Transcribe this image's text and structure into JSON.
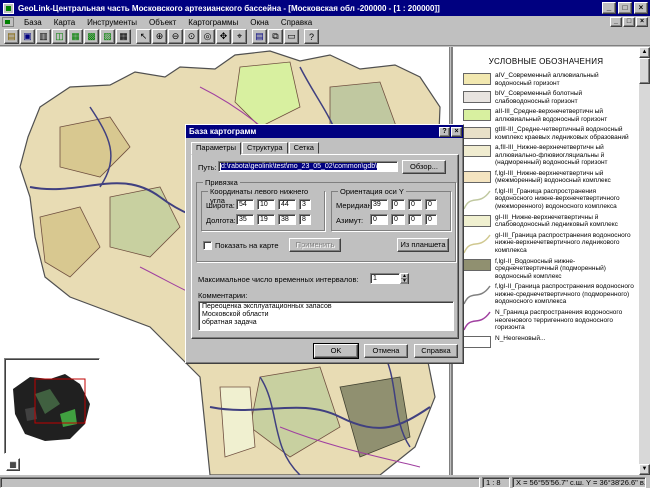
{
  "window": {
    "title": "GeoLink-Центральная часть Московского артезианского бассейна - [Московская обл -200000 - [1 : 200000]]",
    "controls": [
      "_",
      "□",
      "×"
    ],
    "mdi_controls": [
      "_",
      "□",
      "×"
    ]
  },
  "menu": {
    "items": [
      "База",
      "Карта",
      "Инструменты",
      "Объект",
      "Картограммы",
      "Окна",
      "Справка"
    ]
  },
  "toolbar": {
    "buttons": [
      "open-icon",
      "save-icon",
      "print-icon",
      "layers-icon",
      "chart-icon",
      "table-icon",
      "image-icon",
      "grid-icon",
      "pointer-icon",
      "zoom-in-icon",
      "zoom-out-icon",
      "zoom-extent-icon",
      "zoom-region-icon",
      "pan-icon",
      "measure-icon",
      "info-icon",
      "copy-icon",
      "clipboard-icon",
      "help-icon"
    ]
  },
  "legend": {
    "title": "УСЛОВНЫЕ ОБОЗНАЧЕНИЯ",
    "items": [
      {
        "color": "#f2e8b0",
        "kind": "fill",
        "text": "aIV_Современный аллювиальный водоносный горизонт"
      },
      {
        "color": "#e8e4e0",
        "kind": "fill",
        "text": "bIV_Современный болотный слабоводоносный горизонт"
      },
      {
        "color": "#d8f0a0",
        "kind": "fill",
        "text": "aII-III_Средне-верхнечетвертичн ый аллювиальный водоносный горизонт"
      },
      {
        "color": "#e8e0c8",
        "kind": "fill",
        "text": "gtIII-III_Средне-четвертичный водоносный комплекс краевых ледниковых образований"
      },
      {
        "color": "#f0ecd0",
        "kind": "fill",
        "text": "a,fII-III_Нижне-верхнечетвертичн ый аллювиально-флювиогляциальны й (надморенный) водоносный горизонт"
      },
      {
        "color": "#f4e4c0",
        "kind": "fill",
        "text": "f,lgI-III_Нижне-верхнечетвертичн ый (межморенный) водоносный комплекс"
      },
      {
        "color": "#c0c8a0",
        "kind": "line",
        "text": "f,lgI-III_Граница распространения водоносного нижне-верхнечетвертичного (межморенного) водоносного комплекса"
      },
      {
        "color": "#f0f0d0",
        "kind": "fill",
        "text": "gI-III_Нижне-верхнечетвертичны й слабоводоносный ледниковый комплекс"
      },
      {
        "color": "#d0c890",
        "kind": "line",
        "text": "gI-III_Граница распространения водоносного нижне-верхнечетвертичного ледникового комплекса"
      },
      {
        "color": "#909070",
        "kind": "fill",
        "text": "f,lgI-II_Водоносный нижне-среднечетвертичный (подморенный) водоносный комплекс"
      },
      {
        "color": "#808080",
        "kind": "line",
        "text": "f,lgI-II_Граница распространения водоносного нижне-среднечетвертичного (подморенного) водоносного комплекса"
      },
      {
        "color": "#a040a0",
        "kind": "line",
        "text": "N_Граница распространения водоносного неогенового терригенного водоносного горизонта"
      },
      {
        "color": "#ffffff",
        "kind": "fill",
        "text": "N_Неогеновый..."
      }
    ]
  },
  "dialog": {
    "title": "База картограмм",
    "title_buttons": [
      "?",
      "×"
    ],
    "tabs": [
      "Параметры",
      "Структура",
      "Сетка"
    ],
    "path_label": "Путь:",
    "path_value": "d:\\rabota\\geolink\\test\\mo_23_05_02\\common\\gdb\\",
    "browse_button": "Обзор...",
    "binding_group": "Привязка",
    "coords_group": "Координаты левого нижнего угла",
    "lat_label": "Широта:",
    "lat_values": [
      "54",
      "10",
      "44",
      "3"
    ],
    "lon_label": "Долгота:",
    "lon_values": [
      "35",
      "19",
      "38",
      "8"
    ],
    "orient_group": "Ориентация оси Y",
    "meridian_label": "Меридиан:",
    "meridian_values": [
      "39",
      "0",
      "0",
      "0"
    ],
    "azimuth_label": "Азимут:",
    "azimuth_values": [
      "0",
      "0",
      "0",
      "0"
    ],
    "show_on_map_label": "Показать на карте",
    "show_on_map_checked": false,
    "apply_button": "Применить",
    "from_tablet_button": "Из планшета",
    "max_intervals_label": "Максимальное число временных интервалов:",
    "max_intervals_value": "1",
    "comments_label": "Комментарии:",
    "comments_lines": [
      "Переоценка эксплуатационных запасов",
      "Московской области",
      "обратная задача"
    ],
    "ok_button": "OK",
    "cancel_button": "Отмена",
    "help_button": "Справка"
  },
  "status": {
    "scale": "1 : 8",
    "coords": "X = 56°55'56.7\" с.ш. Y = 36°38'26.6\" в.д"
  },
  "colors": {
    "title_bar": "#000080",
    "face": "#c0c0c0",
    "map_land": "#e8dcb4",
    "map_river": "#404080"
  }
}
